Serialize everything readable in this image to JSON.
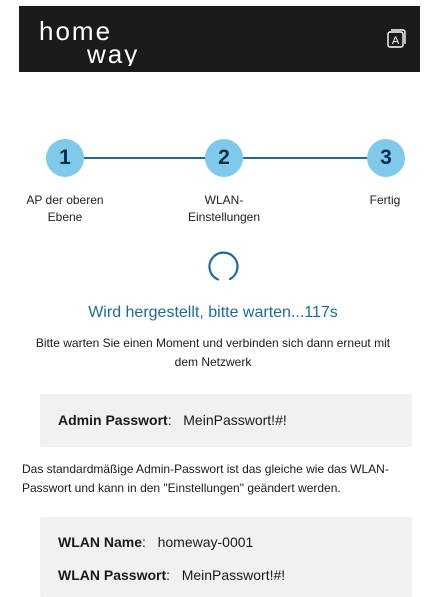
{
  "header": {
    "logo_line1": "home",
    "logo_line2": "way",
    "lang_icon": "language-a-icon",
    "lang_label": "A"
  },
  "stepper": {
    "steps": [
      {
        "number": "1",
        "label_line1": "AP der oberen",
        "label_line2": "Ebene"
      },
      {
        "number": "2",
        "label_line1": "WLAN-",
        "label_line2": "Einstellungen"
      },
      {
        "number": "3",
        "label_line1": "Fertig",
        "label_line2": ""
      }
    ]
  },
  "progress": {
    "spinner_icon": "loading-spinner-icon",
    "status_text": "Wird hergestellt, bitte warten...117s",
    "hint": "Bitte warten Sie einen Moment und verbinden sich dann erneut mit dem Netzwerk"
  },
  "admin": {
    "key": "Admin Passwort",
    "value": "MeinPasswort!#!"
  },
  "note": "Das standardmäßige Admin-Passwort ist das gleiche wie das WLAN-Passwort und kann in den \"Einstellungen\" geändert werden.",
  "wlan": {
    "name_key": "WLAN Name",
    "name_value": "homeway-0001",
    "password_key": "WLAN Passwort",
    "password_value": "MeinPasswort!#!"
  },
  "colors": {
    "header_bg": "#1b1b1b",
    "accent": "#1f6a9a",
    "step_fill": "#7fc9ea",
    "card_bg": "#f1f1f1"
  }
}
